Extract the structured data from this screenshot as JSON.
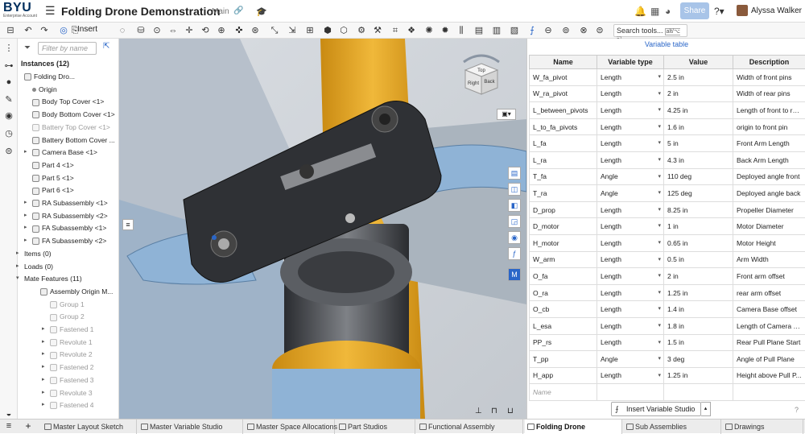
{
  "header": {
    "logo_text": "BYU",
    "logo_sub": "Enterprise Account",
    "doc_title": "Folding Drone Demonstration",
    "branch": "Main",
    "share_label": "Share",
    "user_name": "Alyssa Walker"
  },
  "toolbar": {
    "insert_label": "Insert",
    "search_placeholder": "Search tools...",
    "search_shortcut": "alt/⌥ c"
  },
  "tree": {
    "filter_placeholder": "Filter by name",
    "instances_header": "Instances (12)",
    "items": [
      {
        "label": "Folding Dro...",
        "dim": false
      },
      {
        "label": "Origin",
        "dim": false
      },
      {
        "label": "Body Top Cover <1>",
        "dim": false
      },
      {
        "label": "Body Bottom Cover <1>",
        "dim": false
      },
      {
        "label": "Battery Top Cover <1>",
        "dim": true
      },
      {
        "label": "Battery Bottom Cover ...",
        "dim": false
      },
      {
        "label": "Camera Base <1>",
        "dim": false
      },
      {
        "label": "Part 4 <1>",
        "dim": false
      },
      {
        "label": "Part 5 <1>",
        "dim": false
      },
      {
        "label": "Part 6 <1>",
        "dim": false
      },
      {
        "label": "RA Subassembly <1>",
        "dim": false
      },
      {
        "label": "RA Subassembly <2>",
        "dim": false
      },
      {
        "label": "FA Subassembly <1>",
        "dim": false
      },
      {
        "label": "FA Subassembly <2>",
        "dim": false
      },
      {
        "label": "Items (0)",
        "dim": false
      },
      {
        "label": "Loads (0)",
        "dim": false
      },
      {
        "label": "Mate Features (11)",
        "dim": false
      },
      {
        "label": "Assembly Origin M...",
        "dim": false
      },
      {
        "label": "Group 1",
        "dim": true
      },
      {
        "label": "Group 2",
        "dim": true
      },
      {
        "label": "Fastened 1",
        "dim": true
      },
      {
        "label": "Revolute 1",
        "dim": true
      },
      {
        "label": "Revolute 2",
        "dim": true
      },
      {
        "label": "Fastened 2",
        "dim": true
      },
      {
        "label": "Fastened 3",
        "dim": true
      },
      {
        "label": "Revolute 3",
        "dim": true
      },
      {
        "label": "Fastened 4",
        "dim": true
      }
    ]
  },
  "viewcube": {
    "face_top": "Top",
    "face_front": "Right",
    "face_back": "Back"
  },
  "vartable": {
    "header": "Variable table",
    "columns": [
      "Name",
      "Variable type",
      "Value",
      "Description"
    ],
    "rows": [
      [
        "W_fa_pivot",
        "Length",
        "2.5 in",
        "Width of front pins"
      ],
      [
        "W_ra_pivot",
        "Length",
        "2 in",
        "Width of rear pins"
      ],
      [
        "L_between_pivots",
        "Length",
        "4.25 in",
        "Length of front to re..."
      ],
      [
        "L_to_fa_pivots",
        "Length",
        "1.6 in",
        "origin to front pin"
      ],
      [
        "L_fa",
        "Length",
        "5 in",
        "Front Arm Length"
      ],
      [
        "L_ra",
        "Length",
        "4.3 in",
        "Back Arm Length"
      ],
      [
        "T_fa",
        "Angle",
        "110 deg",
        "Deployed angle front"
      ],
      [
        "T_ra",
        "Angle",
        "125 deg",
        "Deployed angle back"
      ],
      [
        "D_prop",
        "Length",
        "8.25 in",
        "Propeller Diameter"
      ],
      [
        "D_motor",
        "Length",
        "1 in",
        "Motor Diameter"
      ],
      [
        "H_motor",
        "Length",
        "0.65 in",
        "Motor Height"
      ],
      [
        "W_arm",
        "Length",
        "0.5 in",
        "Arm Width"
      ],
      [
        "O_fa",
        "Length",
        "2 in",
        "Front arm offset"
      ],
      [
        "O_ra",
        "Length",
        "1.25 in",
        "rear arm offset"
      ],
      [
        "O_cb",
        "Length",
        "1.4 in",
        "Camera Base offset"
      ],
      [
        "L_esa",
        "Length",
        "1.8 in",
        "Length of Camera S..."
      ],
      [
        "PP_rs",
        "Length",
        "1.5 in",
        "Rear Pull Plane Start"
      ],
      [
        "T_pp",
        "Angle",
        "3 deg",
        "Angle of Pull Plane"
      ],
      [
        "H_app",
        "Length",
        "1.25 in",
        "Height above Pull P..."
      ]
    ],
    "name_placeholder": "Name",
    "insert_button": "Insert Variable Studio"
  },
  "tabs": [
    {
      "label": "Master Layout Sketch",
      "active": false
    },
    {
      "label": "Master Variable Studio",
      "active": false
    },
    {
      "label": "Master Space Allocations",
      "active": false
    },
    {
      "label": "Part Studios",
      "active": false
    },
    {
      "label": "Functional Assembly",
      "active": false
    },
    {
      "label": "Folding Drone",
      "active": true
    },
    {
      "label": "Sub Assemblies",
      "active": false
    },
    {
      "label": "Drawings",
      "active": false
    }
  ],
  "colors": {
    "accent": "#2a66c8",
    "brand": "#002e5d",
    "orange": "#e8a31c",
    "blue_part": "#8fb3d6",
    "dark_part": "#2f3135"
  }
}
